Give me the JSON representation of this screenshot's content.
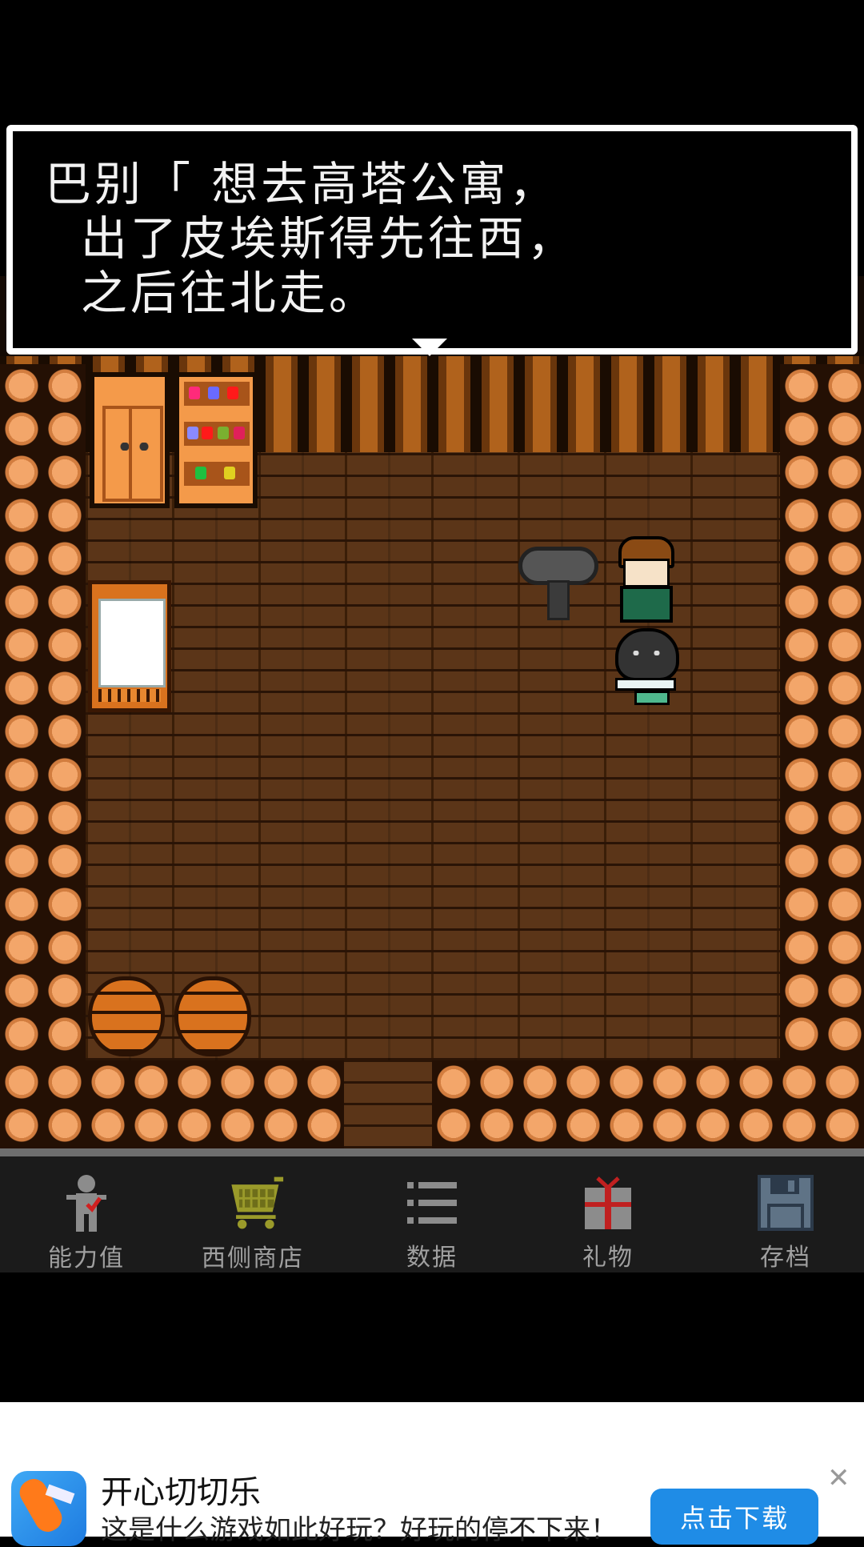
{
  "dialog": {
    "lines": [
      "巴别「 想去高塔公寓，",
      "  出了皮埃斯得先往西，",
      "  之后往北走。"
    ]
  },
  "menu": {
    "items": [
      {
        "label": "能力值",
        "icon": "stats-figure-icon"
      },
      {
        "label": "西侧商店",
        "icon": "shopping-cart-icon"
      },
      {
        "label": "数据",
        "icon": "list-icon"
      },
      {
        "label": "礼物",
        "icon": "gift-icon"
      },
      {
        "label": "存档",
        "icon": "floppy-disk-icon"
      }
    ]
  },
  "ad": {
    "title": "开心切切乐",
    "description": "这是什么游戏如此好玩？好玩的停不下来！",
    "download_label": "点击下载",
    "close_symbol": "✕"
  },
  "colors": {
    "menu_text": "#a0a0a0",
    "download_button": "#1f8ce6",
    "wall_stone": "#f3a66a",
    "floor": "#5b3518"
  }
}
